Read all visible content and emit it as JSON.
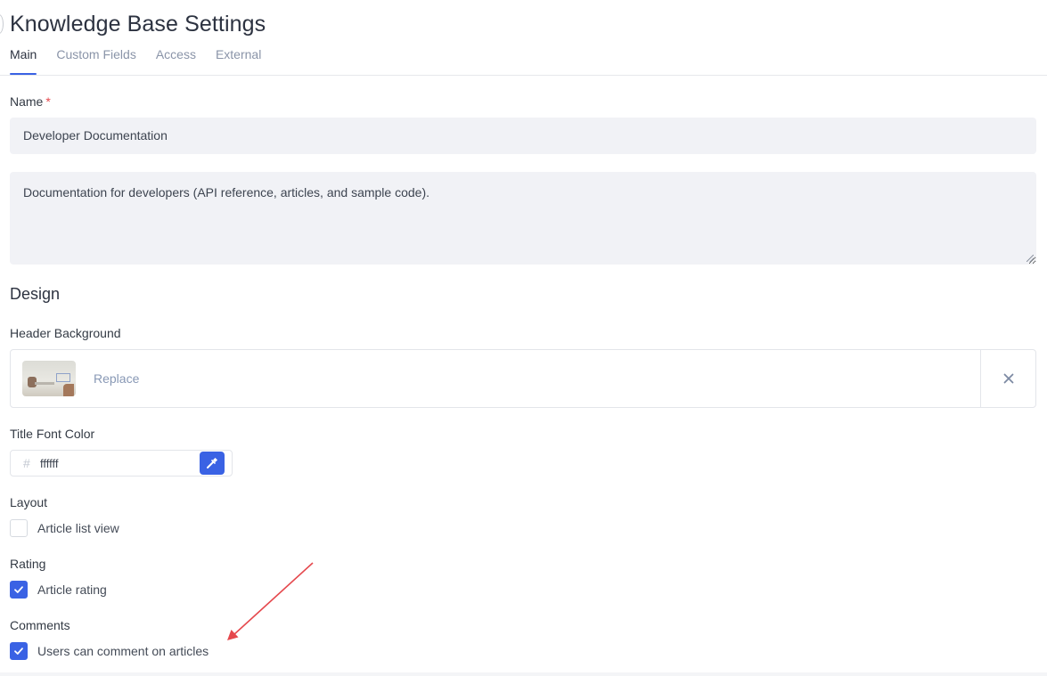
{
  "header": {
    "title": "Knowledge Base Settings",
    "tabs": [
      {
        "label": "Main",
        "active": true
      },
      {
        "label": "Custom Fields",
        "active": false
      },
      {
        "label": "Access",
        "active": false
      },
      {
        "label": "External",
        "active": false
      }
    ]
  },
  "form": {
    "name_label": "Name",
    "required_mark": "*",
    "name_value": "Developer Documentation",
    "description_value": "Documentation for developers (API reference, articles, and sample code).",
    "design_title": "Design",
    "header_background": {
      "label": "Header Background",
      "replace_label": "Replace",
      "remove_icon": "close-icon"
    },
    "title_font_color": {
      "label": "Title Font Color",
      "hash": "#",
      "value": "ffffff",
      "picker_icon": "eyedropper-icon"
    },
    "layout": {
      "label": "Layout",
      "option_label": "Article list view",
      "checked": false
    },
    "rating": {
      "label": "Rating",
      "option_label": "Article rating",
      "checked": true
    },
    "comments": {
      "label": "Comments",
      "option_label": "Users can comment on articles",
      "checked": true
    }
  },
  "colors": {
    "accent": "#3a62e4",
    "annotation_arrow": "#e5484d",
    "required": "#e5484d"
  }
}
